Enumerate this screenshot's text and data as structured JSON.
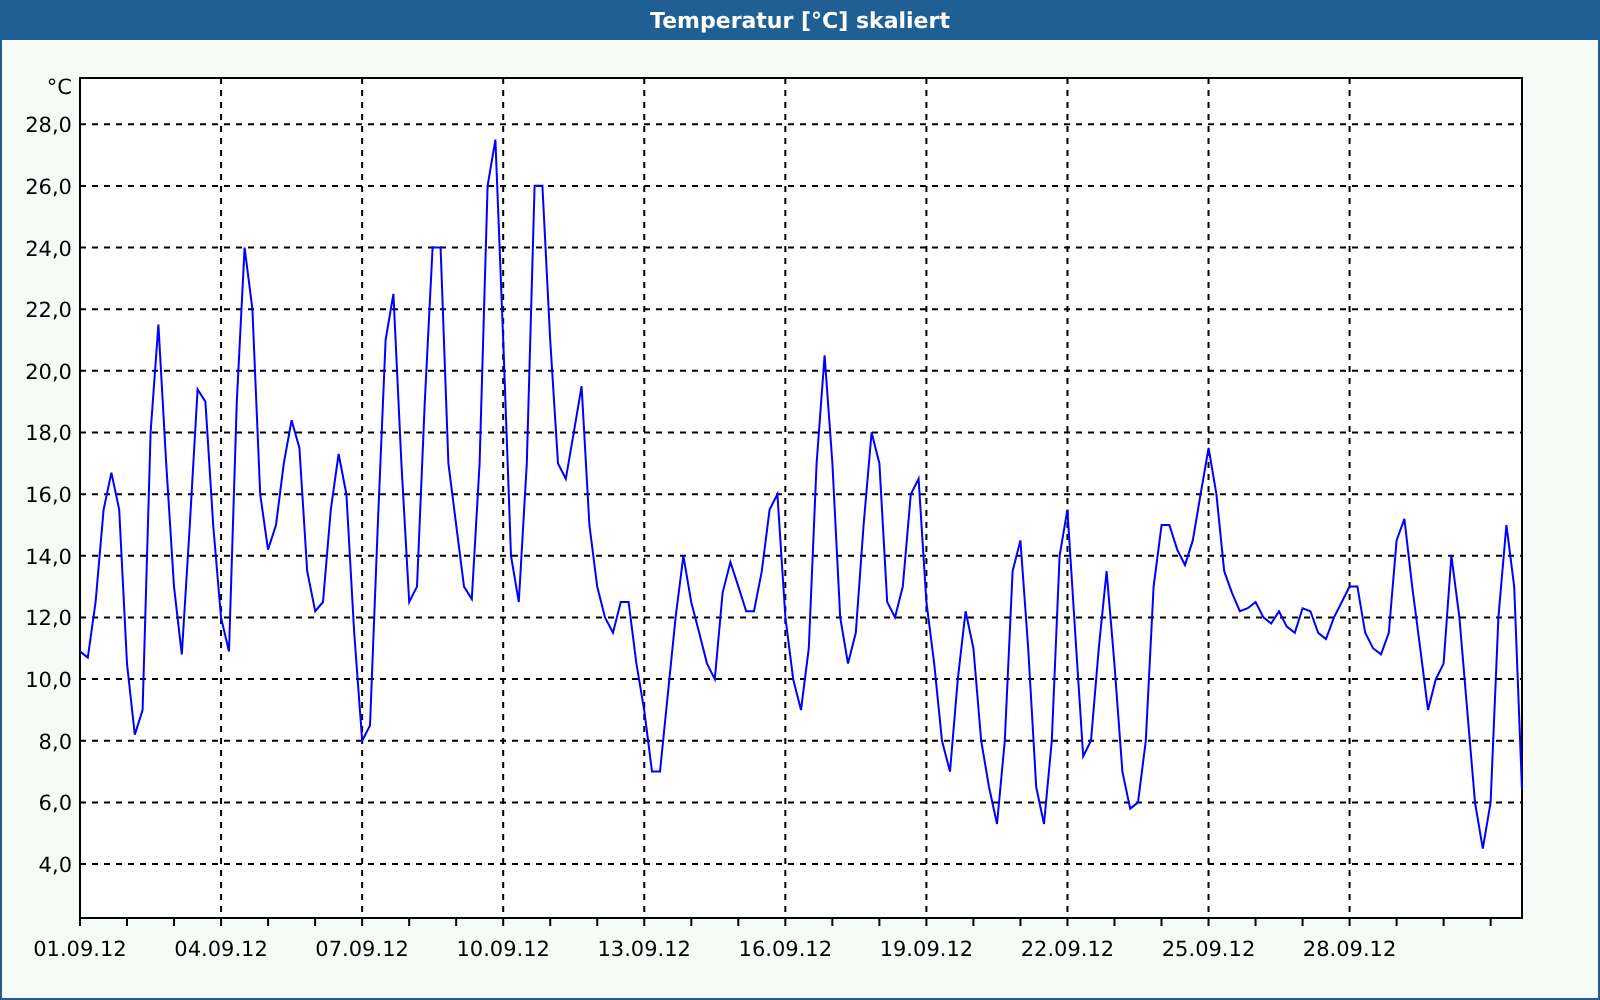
{
  "window": {
    "title": "Temperatur [°C] skaliert"
  },
  "chart": {
    "chart_data": {
      "type": "line",
      "ylabel": "°C",
      "grid": true,
      "categories": [
        "01.09.12",
        null,
        null,
        null,
        null,
        null,
        null,
        null,
        null,
        null,
        null,
        null,
        null,
        null,
        null,
        null,
        null,
        null,
        "04.09.12",
        null,
        null,
        null,
        null,
        null,
        null,
        null,
        null,
        null,
        null,
        null,
        null,
        null,
        null,
        null,
        null,
        null,
        "07.09.12",
        null,
        null,
        null,
        null,
        null,
        null,
        null,
        null,
        null,
        null,
        null,
        null,
        null,
        null,
        null,
        null,
        null,
        "10.09.12",
        null,
        null,
        null,
        null,
        null,
        null,
        null,
        null,
        null,
        null,
        null,
        null,
        null,
        null,
        null,
        null,
        null,
        "13.09.12",
        null,
        null,
        null,
        null,
        null,
        null,
        null,
        null,
        null,
        null,
        null,
        null,
        null,
        null,
        null,
        null,
        null,
        "16.09.12",
        null,
        null,
        null,
        null,
        null,
        null,
        null,
        null,
        null,
        null,
        null,
        null,
        null,
        null,
        null,
        null,
        null,
        "19.09.12",
        null,
        null,
        null,
        null,
        null,
        null,
        null,
        null,
        null,
        null,
        null,
        null,
        null,
        null,
        null,
        null,
        null,
        "22.09.12",
        null,
        null,
        null,
        null,
        null,
        null,
        null,
        null,
        null,
        null,
        null,
        null,
        null,
        null,
        null,
        null,
        null,
        "25.09.12",
        null,
        null,
        null,
        null,
        null,
        null,
        null,
        null,
        null,
        null,
        null,
        null,
        null,
        null,
        null,
        null,
        null,
        "28.09.12",
        null,
        null,
        null,
        null,
        null,
        null,
        null,
        null,
        null,
        null,
        null,
        null,
        null,
        null,
        null,
        null,
        null,
        null,
        null,
        null,
        null,
        null
      ],
      "series": [
        {
          "color": "#0000ff",
          "values": [
            10.9,
            10.7,
            12.5,
            15.5,
            16.7,
            15.5,
            10.5,
            8.2,
            9,
            18,
            21.5,
            17,
            13,
            10.8,
            15,
            19.4,
            19,
            15,
            12,
            10.9,
            19,
            24,
            22,
            16,
            14.2,
            15,
            17,
            18.4,
            17.5,
            13.5,
            12.2,
            12.5,
            15.5,
            17.3,
            16,
            11.5,
            8,
            8.5,
            15,
            21,
            22.5,
            17,
            12.5,
            13,
            19,
            24,
            24,
            17,
            15,
            13,
            12.6,
            17,
            26,
            27.5,
            21,
            14,
            12.5,
            17,
            26,
            26,
            21,
            17,
            16.5,
            18,
            19.5,
            15,
            13,
            12,
            11.5,
            12.5,
            12.5,
            10.5,
            9,
            7,
            7,
            9.5,
            12,
            14,
            12.5,
            11.5,
            10.5,
            10,
            12.8,
            13.8,
            13,
            12.2,
            12.2,
            13.5,
            15.5,
            16,
            12,
            10,
            9,
            11,
            17,
            20.5,
            17,
            12,
            10.5,
            11.5,
            15,
            18,
            17,
            12.5,
            12,
            13,
            16,
            16.5,
            12.5,
            10.5,
            8,
            7,
            10,
            12.2,
            11,
            8,
            6.5,
            5.3,
            8,
            13.5,
            14.5,
            11,
            6.5,
            5.3,
            8,
            14,
            15.5,
            11.5,
            7.5,
            8,
            11,
            13.5,
            10.5,
            7,
            5.8,
            6,
            8,
            13,
            15,
            15,
            14.2,
            13.7,
            14.5,
            16,
            17.5,
            16,
            13.5,
            12.8,
            12.2,
            12.3,
            12.5,
            12,
            11.8,
            12.2,
            11.7,
            11.5,
            12.3,
            12.2,
            11.5,
            11.3,
            12,
            12.5,
            13,
            13,
            11.5,
            11,
            10.8,
            11.5,
            14.5,
            15.2,
            13,
            11,
            9,
            10,
            10.5,
            14,
            12,
            9,
            6,
            4.5,
            6,
            12,
            15,
            13,
            6.4
          ]
        }
      ],
      "ylim": [
        2.25,
        29.5
      ],
      "yticks": [
        {
          "value": 4,
          "label": "4,0"
        },
        {
          "value": 6,
          "label": "6,0"
        },
        {
          "value": 8,
          "label": "8,0"
        },
        {
          "value": 10,
          "label": "10,0"
        },
        {
          "value": 12,
          "label": "12,0"
        },
        {
          "value": 14,
          "label": "14,0"
        },
        {
          "value": 16,
          "label": "16,0"
        },
        {
          "value": 18,
          "label": "18,0"
        },
        {
          "value": 20,
          "label": "20,0"
        },
        {
          "value": 22,
          "label": "22,0"
        },
        {
          "value": 24,
          "label": "24,0"
        },
        {
          "value": 26,
          "label": "26,0"
        },
        {
          "value": 28,
          "label": "28,0"
        }
      ]
    }
  }
}
